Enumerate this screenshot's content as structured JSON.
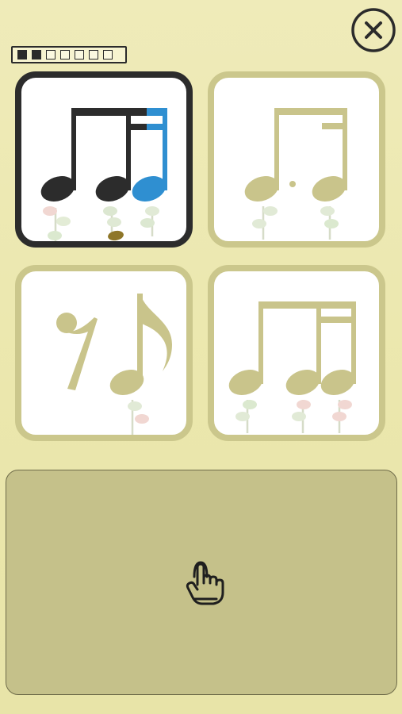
{
  "progress": {
    "total": 7,
    "completed": 2
  },
  "colors": {
    "background": "#ebe7ad",
    "card_border": "#cbc78c",
    "card_selected_border": "#2c2c2c",
    "note_dark": "#2c2c2c",
    "note_active": "#2f8fd1",
    "note_inactive": "#c9c48b",
    "tap_pad": "#c5c18a"
  },
  "icons": {
    "close": "close-icon",
    "tap": "pointing-hand-icon"
  },
  "options": [
    {
      "id": "triplet-eighth-eighth-two-sixteenths",
      "selected": true
    },
    {
      "id": "dotted-eighth-sixteenth",
      "selected": false
    },
    {
      "id": "eighth-rest-eighth",
      "selected": false
    },
    {
      "id": "eighth-two-sixteenths",
      "selected": false
    }
  ]
}
